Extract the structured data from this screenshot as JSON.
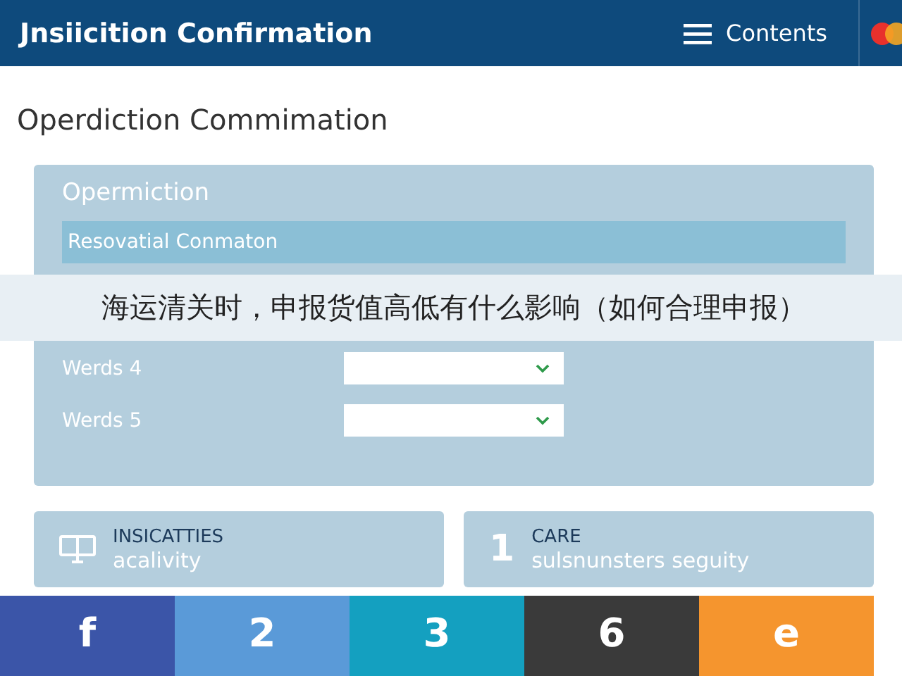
{
  "header": {
    "title": "Jnsiicition Confirmation",
    "menu_label": "Contents"
  },
  "page_title": "Operdiction Commimation",
  "form_card": {
    "title": "Opermiction",
    "section_bar": "Resovatial Conmaton",
    "caption_banner": "海运清关时，申报货值高低有什么影响（如何合理申报）",
    "rows": [
      {
        "label": "Werds 4"
      },
      {
        "label": "Werds 5"
      }
    ]
  },
  "info_cards": [
    {
      "kind": "icon",
      "title": "INSICATTIES",
      "subtitle": "acalivity"
    },
    {
      "kind": "number",
      "number": "1",
      "title": "CARE",
      "subtitle": "sulsnunsters seguity"
    }
  ],
  "tiles": [
    {
      "label": "f",
      "color": "#3b55a8"
    },
    {
      "label": "2",
      "color": "#5a9ad8"
    },
    {
      "label": "3",
      "color": "#14a0c0"
    },
    {
      "label": "6",
      "color": "#3a3a3a"
    },
    {
      "label": "e",
      "color": "#f5952e"
    }
  ]
}
